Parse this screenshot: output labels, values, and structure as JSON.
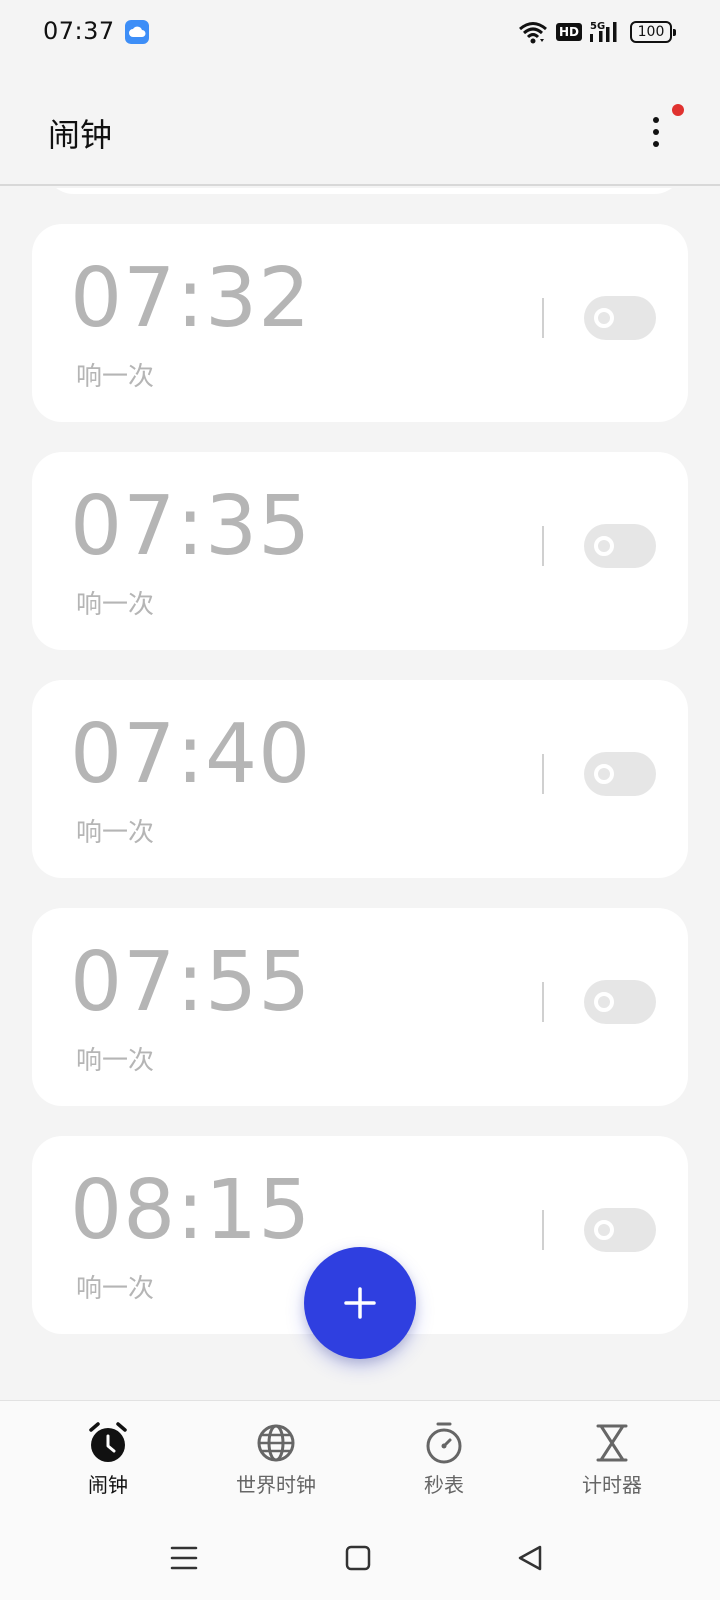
{
  "status_bar": {
    "time": "07:37",
    "network_badge": "HD",
    "network_type": "5G",
    "battery": "100",
    "icons": [
      "cloud-app-icon",
      "wifi-icon",
      "hd-icon",
      "signal-5g-icon",
      "battery-icon"
    ]
  },
  "header": {
    "title": "闹钟",
    "menu_icon": "more-vertical-icon",
    "has_notification_dot": true
  },
  "alarms": [
    {
      "time": "07:32",
      "repeat": "响一次",
      "enabled": false
    },
    {
      "time": "07:35",
      "repeat": "响一次",
      "enabled": false
    },
    {
      "time": "07:40",
      "repeat": "响一次",
      "enabled": false
    },
    {
      "time": "07:55",
      "repeat": "响一次",
      "enabled": false
    },
    {
      "time": "08:15",
      "repeat": "响一次",
      "enabled": false
    }
  ],
  "fab": {
    "icon": "plus-icon"
  },
  "bottom_nav": {
    "items": [
      {
        "label": "闹钟",
        "icon": "alarm-clock-icon",
        "active": true
      },
      {
        "label": "世界时钟",
        "icon": "globe-icon",
        "active": false
      },
      {
        "label": "秒表",
        "icon": "stopwatch-icon",
        "active": false
      },
      {
        "label": "计时器",
        "icon": "hourglass-icon",
        "active": false
      }
    ]
  },
  "system_nav": {
    "icons": [
      "menu-icon",
      "home-icon",
      "back-icon"
    ]
  },
  "colors": {
    "accent": "#2f3fe0",
    "notification": "#e0322f",
    "background": "#f4f4f4",
    "card": "#ffffff",
    "disabled_text": "#b5b5b5"
  }
}
